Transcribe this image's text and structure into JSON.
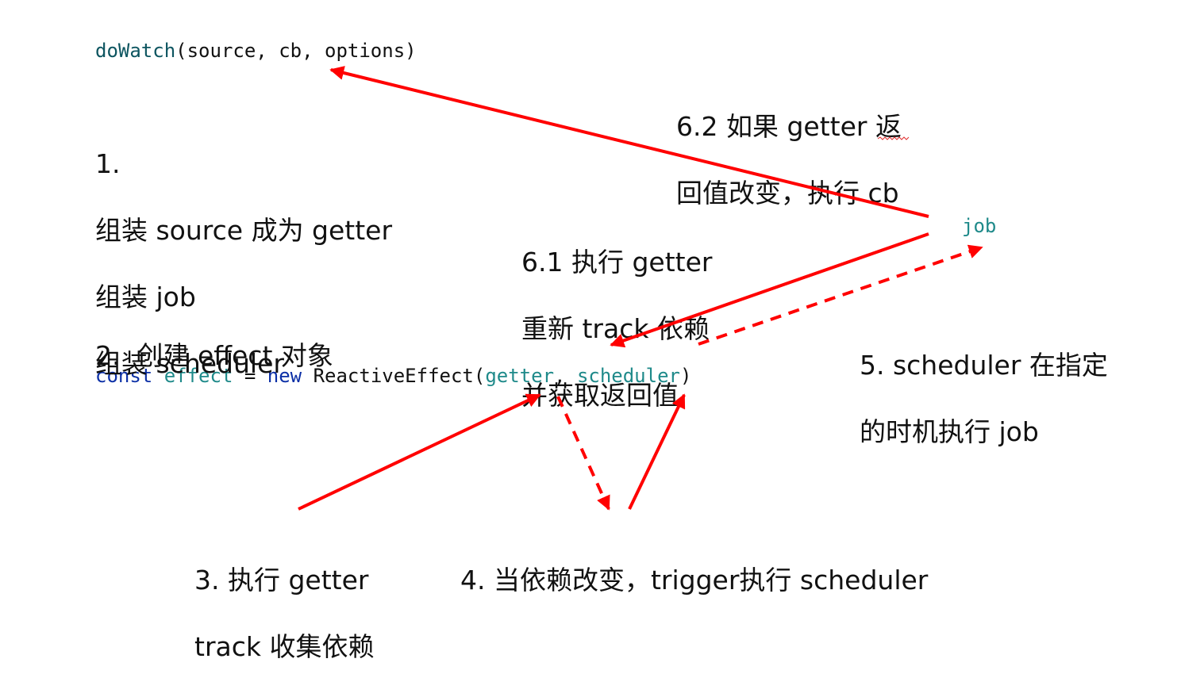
{
  "code": {
    "dowatch_fn": "doWatch",
    "dowatch_args": "(source, cb, options)",
    "const_kw": "const",
    "effect_var": "effect",
    "equals": " = ",
    "new_kw": "new",
    "class_name": "ReactiveEffect(",
    "arg_getter": "getter",
    "comma": ", ",
    "arg_scheduler": "scheduler",
    "close_paren": ")",
    "job": "job"
  },
  "steps": {
    "step1": {
      "line1": "1.",
      "line2": "组装 source 成为 getter",
      "line3": "组装 job",
      "line4": "组装 scheduler"
    },
    "step2": {
      "line1": "2.  创建 effect 对象"
    },
    "step3": {
      "line1": "3. 执行 getter",
      "line2": "track 收集依赖"
    },
    "step4": {
      "line1": "4. 当依赖改变，trigger执行 scheduler"
    },
    "step5": {
      "line1": "5. scheduler 在指定",
      "line2": "的时机执行 job"
    },
    "step61": {
      "line1": "6.1 执行 getter",
      "line2": "重新 track 依赖",
      "line3": "并获取返回值"
    },
    "step62": {
      "line1": "6.2 如果 getter 返",
      "line2": "回值改变，执行 cb"
    }
  },
  "colors": {
    "arrow": "#ff0000",
    "keyword": "#0b2fa6",
    "identifier": "#1f8a8a"
  }
}
